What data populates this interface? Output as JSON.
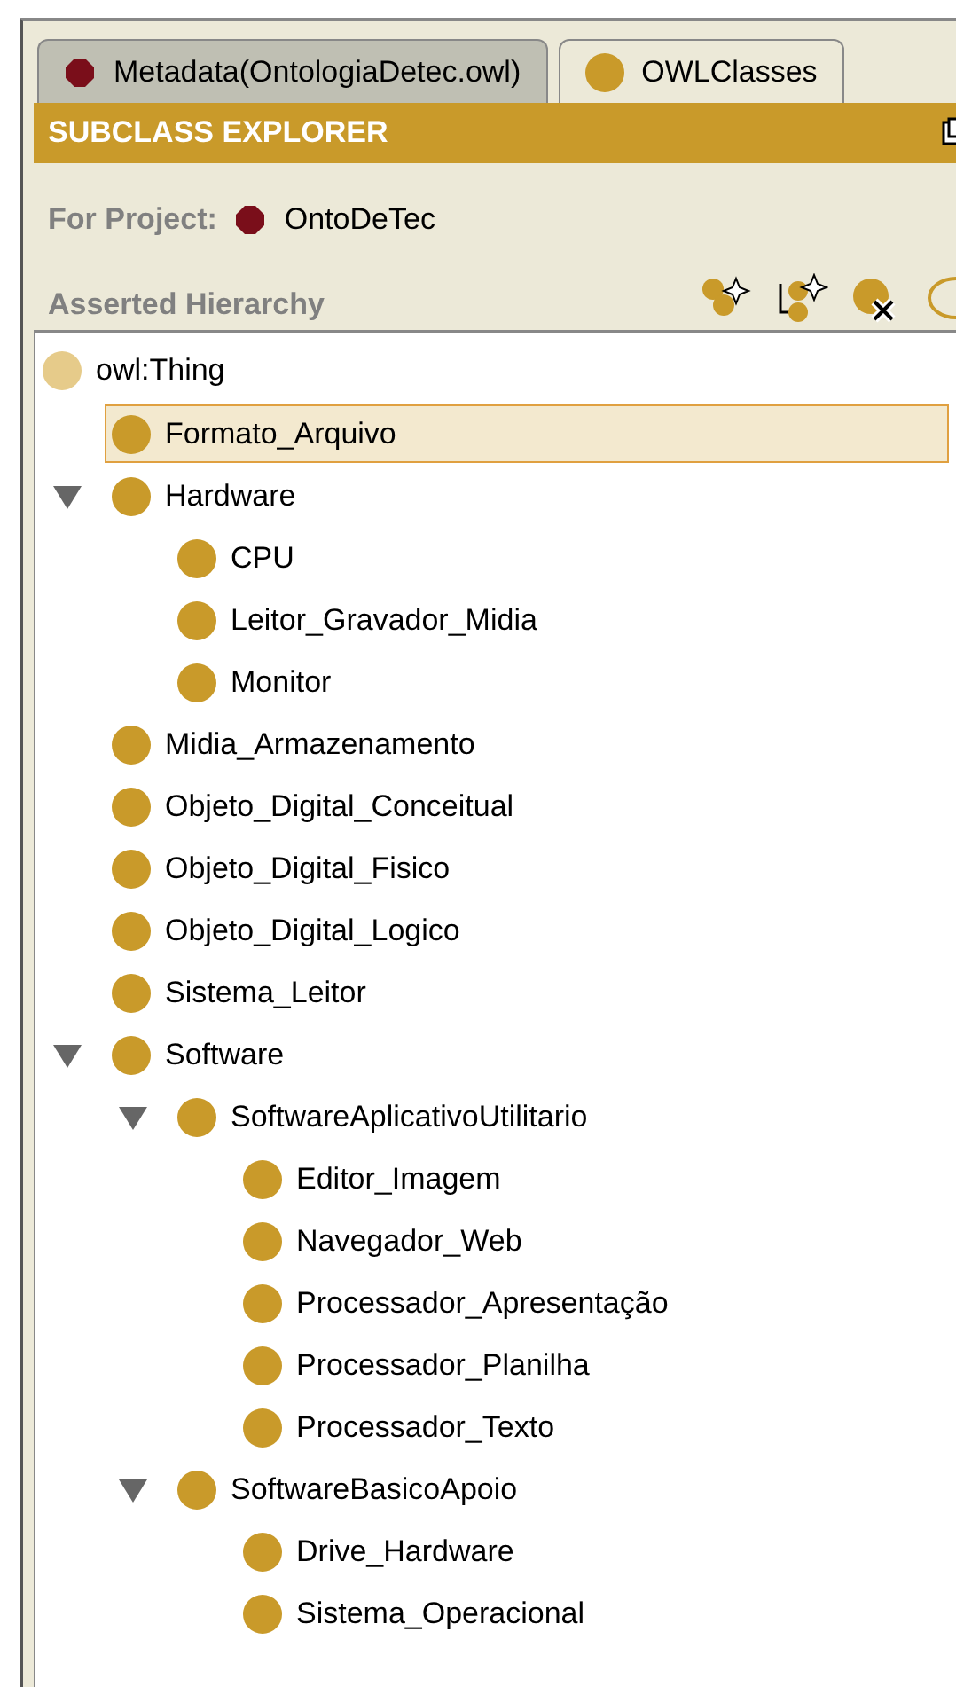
{
  "tabs": [
    {
      "label": "Metadata(OntologiaDetec.owl)",
      "kind": "project",
      "selected": false
    },
    {
      "label": "OWLClasses",
      "kind": "class",
      "selected": true
    }
  ],
  "panel": {
    "title": "SUBCLASS EXPLORER",
    "project_label": "For Project:",
    "project_name": "OntoDeTec",
    "hierarchy_label": "Asserted Hierarchy"
  },
  "tree": {
    "root": {
      "label": "owl:Thing",
      "children": [
        {
          "label": "Formato_Arquivo",
          "selected": true
        },
        {
          "label": "Hardware",
          "expanded": true,
          "selected": false,
          "children": [
            {
              "label": "CPU",
              "selected": false
            },
            {
              "label": "Leitor_Gravador_Midia",
              "selected": false
            },
            {
              "label": "Monitor",
              "selected": false
            }
          ]
        },
        {
          "label": "Midia_Armazenamento",
          "selected": false
        },
        {
          "label": "Objeto_Digital_Conceitual",
          "selected": false
        },
        {
          "label": "Objeto_Digital_Fisico",
          "selected": false
        },
        {
          "label": "Objeto_Digital_Logico",
          "selected": false
        },
        {
          "label": "Sistema_Leitor",
          "selected": false
        },
        {
          "label": "Software",
          "expanded": true,
          "selected": false,
          "children": [
            {
              "label": "SoftwareAplicativoUtilitario",
              "expanded": true,
              "selected": false,
              "children": [
                {
                  "label": "Editor_Imagem",
                  "selected": false
                },
                {
                  "label": "Navegador_Web",
                  "selected": false
                },
                {
                  "label": "Processador_Apresentação",
                  "selected": false
                },
                {
                  "label": "Processador_Planilha",
                  "selected": false
                },
                {
                  "label": "Processador_Texto",
                  "selected": false
                }
              ]
            },
            {
              "label": "SoftwareBasicoApoio",
              "expanded": true,
              "selected": false,
              "children": [
                {
                  "label": "Drive_Hardware",
                  "selected": false
                },
                {
                  "label": "Sistema_Operacional",
                  "selected": false
                }
              ]
            }
          ]
        }
      ]
    }
  }
}
